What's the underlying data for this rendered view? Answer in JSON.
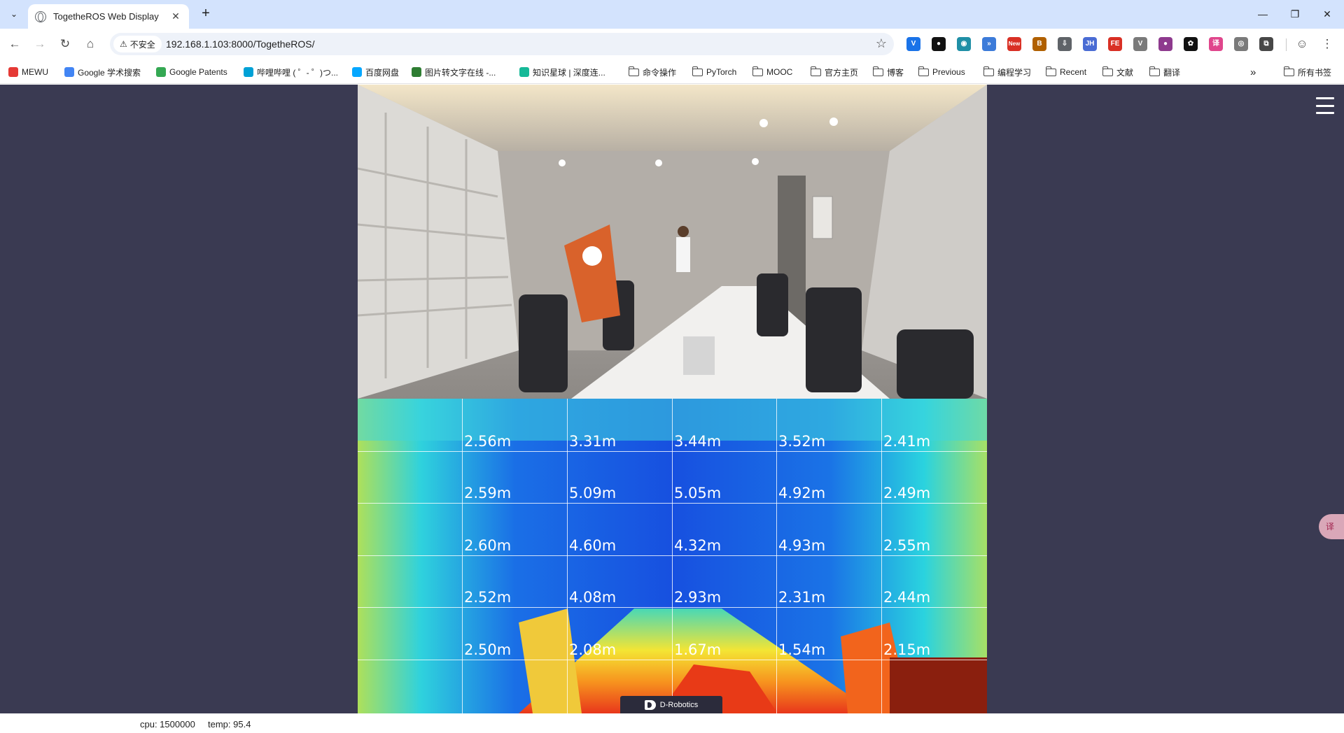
{
  "browser": {
    "tab_title": "TogetheROS Web Display",
    "security_label": "不安全",
    "url": "192.168.1.103:8000/TogetheROS/",
    "buttons": {
      "tab_list": "⌄",
      "tab_close": "✕",
      "new_tab": "+",
      "back": "←",
      "forward": "→",
      "reload": "↻",
      "home": "⌂",
      "bookmark_star": "☆",
      "minimize": "—",
      "maximize": "❐",
      "close": "✕"
    },
    "extensions": [
      {
        "name": "v-extension-icon",
        "glyph": "V",
        "color": "#1a73e8"
      },
      {
        "name": "circle-extension-icon",
        "glyph": "●",
        "color": "#111111"
      },
      {
        "name": "edge-extension-icon",
        "glyph": "◉",
        "color": "#1f8fa6"
      },
      {
        "name": "wave-extension-icon",
        "glyph": "»",
        "color": "#3c7bd9"
      },
      {
        "name": "new-extension-icon",
        "glyph": "New",
        "color": "#d93025"
      },
      {
        "name": "book-extension-icon",
        "glyph": "B",
        "color": "#b06000"
      },
      {
        "name": "download-extension-icon",
        "glyph": "⇩",
        "color": "#5f6368"
      },
      {
        "name": "jh-extension-icon",
        "glyph": "JH",
        "color": "#4a6cd4"
      },
      {
        "name": "fe-extension-icon",
        "glyph": "FE",
        "color": "#d93025"
      },
      {
        "name": "vue-extension-icon",
        "glyph": "V",
        "color": "#7a7a7a"
      },
      {
        "name": "purple-extension-icon",
        "glyph": "●",
        "color": "#8e3a8e"
      },
      {
        "name": "openai-extension-icon",
        "glyph": "✿",
        "color": "#111111"
      },
      {
        "name": "translate-extension-icon",
        "glyph": "译",
        "color": "#e0468c"
      },
      {
        "name": "wechat-extension-icon",
        "glyph": "◎",
        "color": "#7a7a7a"
      },
      {
        "name": "puzzle-extension-icon",
        "glyph": "⧉",
        "color": "#474747"
      }
    ],
    "profile_glyph": "☺",
    "menu_glyph": "⋮"
  },
  "bookmarks": {
    "items": [
      {
        "label": "MEWU",
        "type": "site",
        "color": "#e53935"
      },
      {
        "label": "Google 学术搜索",
        "type": "site",
        "color": "#4285f4"
      },
      {
        "label": "Google Patents",
        "type": "site",
        "color": "#34a853"
      },
      {
        "label": "哔哩哔哩 ( ゜- ゜)つ...",
        "type": "site",
        "color": "#00a1d6"
      },
      {
        "label": "百度网盘",
        "type": "site",
        "color": "#06a7ff"
      },
      {
        "label": "图片转文字在线 -...",
        "type": "site",
        "color": "#2e7d32"
      },
      {
        "label": "知识星球 | 深度连...",
        "type": "site",
        "color": "#16b998"
      },
      {
        "label": "命令操作",
        "type": "folder"
      },
      {
        "label": "PyTorch",
        "type": "folder"
      },
      {
        "label": "MOOC",
        "type": "folder"
      },
      {
        "label": "官方主页",
        "type": "folder"
      },
      {
        "label": "博客",
        "type": "folder"
      },
      {
        "label": "Previous",
        "type": "folder"
      },
      {
        "label": "编程学习",
        "type": "folder"
      },
      {
        "label": "Recent",
        "type": "folder"
      },
      {
        "label": "文献",
        "type": "folder"
      },
      {
        "label": "翻译",
        "type": "folder"
      }
    ],
    "overflow": "»",
    "all_bookmarks": "所有书签"
  },
  "page": {
    "brand": "D-Robotics",
    "depth_readings": [
      [
        "2.56m",
        "3.31m",
        "3.44m",
        "3.52m",
        "2.41m"
      ],
      [
        "2.59m",
        "5.09m",
        "5.05m",
        "4.92m",
        "2.49m"
      ],
      [
        "2.60m",
        "4.60m",
        "4.32m",
        "4.93m",
        "2.55m"
      ],
      [
        "2.52m",
        "4.08m",
        "2.93m",
        "2.31m",
        "2.44m"
      ],
      [
        "2.50m",
        "2.08m",
        "1.67m",
        "1.54m",
        "2.15m"
      ]
    ],
    "translate_glyph": "译"
  },
  "status": {
    "cpu": "cpu: 1500000",
    "temp": "temp: 95.4"
  }
}
